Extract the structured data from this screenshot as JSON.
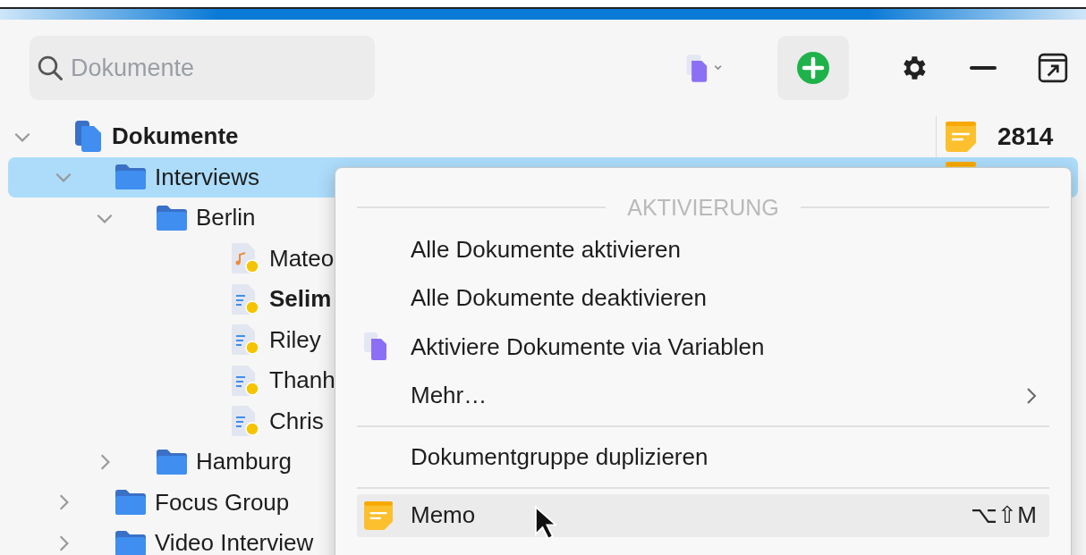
{
  "search": {
    "placeholder": "Dokumente"
  },
  "tree": [
    {
      "label": "Dokumente",
      "kind": "root",
      "bold": true,
      "expanded": true,
      "selected": false,
      "memo": true,
      "count": "2814",
      "children": [
        {
          "label": "Interviews",
          "kind": "folder",
          "bold": false,
          "expanded": true,
          "selected": true,
          "memo": true,
          "children": [
            {
              "label": "Berlin",
              "kind": "folder",
              "bold": false,
              "expanded": true,
              "selected": false,
              "children": [
                {
                  "label": "Mateo",
                  "kind": "audio",
                  "bold": false,
                  "selected": false
                },
                {
                  "label": "Selim",
                  "kind": "text",
                  "bold": true,
                  "selected": false
                },
                {
                  "label": "Riley",
                  "kind": "text",
                  "bold": false,
                  "selected": false
                },
                {
                  "label": "Thanh",
                  "kind": "text",
                  "bold": false,
                  "selected": false
                },
                {
                  "label": "Chris",
                  "kind": "text",
                  "bold": false,
                  "selected": false
                }
              ]
            },
            {
              "label": "Hamburg",
              "kind": "folder",
              "bold": false,
              "expanded": false,
              "selected": false
            }
          ]
        },
        {
          "label": "Focus Group",
          "kind": "folder",
          "bold": false,
          "expanded": false,
          "selected": false
        },
        {
          "label": "Video Interview",
          "kind": "folder",
          "bold": false,
          "expanded": false,
          "selected": false
        }
      ]
    }
  ],
  "menu": {
    "header": "AKTIVIERUNG",
    "items": [
      {
        "kind": "action",
        "label": "Alle Dokumente aktivieren",
        "submenu": false,
        "selected": false
      },
      {
        "kind": "action",
        "label": "Alle Dokumente deaktivieren",
        "submenu": false,
        "selected": false
      },
      {
        "kind": "variables",
        "label": "Aktiviere Dokumente via Variablen",
        "submenu": false,
        "selected": false
      },
      {
        "kind": "action",
        "label": "Mehr…",
        "submenu": true,
        "selected": false
      },
      {
        "kind": "divider"
      },
      {
        "kind": "action",
        "label": "Dokumentgruppe duplizieren",
        "submenu": false,
        "selected": false
      },
      {
        "kind": "divider"
      },
      {
        "kind": "memo",
        "label": "Memo",
        "submenu": false,
        "selected": true,
        "shortcut": "⌥⇧M"
      }
    ]
  }
}
